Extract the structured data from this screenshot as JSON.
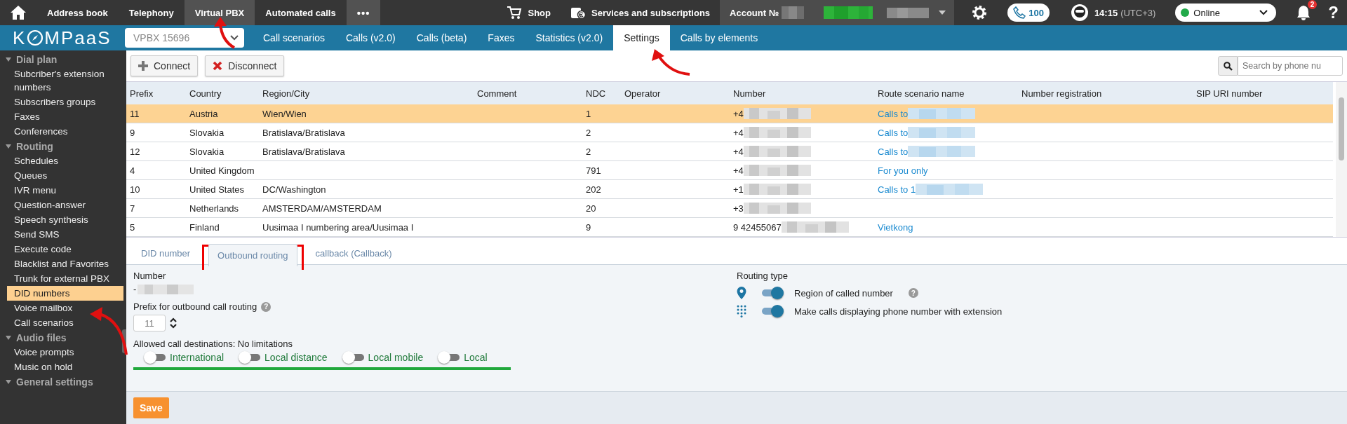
{
  "top_nav": {
    "items": [
      {
        "label": "Address book",
        "selected": false
      },
      {
        "label": "Telephony",
        "selected": false
      },
      {
        "label": "Virtual PBX",
        "selected": true
      },
      {
        "label": "Automated calls",
        "selected": false
      }
    ],
    "more": "•••",
    "shop": "Shop",
    "services": "Services and subscriptions",
    "account": "Account №",
    "calls_count": "100",
    "time": "14:15",
    "timezone": "(UTC+3)",
    "status": "Online",
    "notifications": "2",
    "help": "?"
  },
  "logo": {
    "before": "K",
    "after": "MPaaS"
  },
  "pbx_select": "VPBX 15696",
  "tabs": [
    {
      "label": "Call scenarios",
      "selected": false
    },
    {
      "label": "Calls (v2.0)",
      "selected": false
    },
    {
      "label": "Calls (beta)",
      "selected": false
    },
    {
      "label": "Faxes",
      "selected": false
    },
    {
      "label": "Statistics (v2.0)",
      "selected": false
    },
    {
      "label": "Settings",
      "selected": true
    },
    {
      "label": "Calls by elements",
      "selected": false
    }
  ],
  "sidebar": {
    "groups": [
      {
        "title": "Dial plan",
        "expanded": true,
        "items": [
          {
            "label": "Subcriber's extension numbers",
            "selected": false
          },
          {
            "label": "Subscribers groups",
            "selected": false
          },
          {
            "label": "Faxes",
            "selected": false
          },
          {
            "label": "Conferences",
            "selected": false
          }
        ]
      },
      {
        "title": "Routing",
        "expanded": true,
        "items": [
          {
            "label": "Schedules",
            "selected": false
          },
          {
            "label": "Queues",
            "selected": false
          },
          {
            "label": "IVR menu",
            "selected": false
          },
          {
            "label": "Question-answer",
            "selected": false
          },
          {
            "label": "Speech synthesis",
            "selected": false
          },
          {
            "label": "Send SMS",
            "selected": false
          },
          {
            "label": "Execute code",
            "selected": false
          },
          {
            "label": "Blacklist and Favorites",
            "selected": false
          },
          {
            "label": "Trunk for external PBX",
            "selected": false
          },
          {
            "label": "DID numbers",
            "selected": true
          },
          {
            "label": "Voice mailbox",
            "selected": false
          },
          {
            "label": "Call scenarios",
            "selected": false
          }
        ]
      },
      {
        "title": "Audio files",
        "expanded": true,
        "items": [
          {
            "label": "Voice prompts",
            "selected": false
          },
          {
            "label": "Music on hold",
            "selected": false
          }
        ]
      },
      {
        "title": "General settings",
        "expanded": true
      }
    ]
  },
  "toolbar": {
    "connect": "Connect",
    "disconnect": "Disconnect",
    "search_placeholder": "Search by phone nu"
  },
  "table": {
    "columns": [
      "Prefix",
      "Country",
      "Region/City",
      "Comment",
      "NDC",
      "Operator",
      "Number",
      "Route scenario name",
      "Number registration",
      "SIP URI number"
    ],
    "rows": [
      {
        "selected": true,
        "prefix": "11",
        "country": "Austria",
        "region": "Wien/Wien",
        "ndc": "1",
        "number": {
          "text": "+4",
          "blurred": true
        },
        "route": {
          "text": "Calls to",
          "blurred": true
        }
      },
      {
        "selected": false,
        "prefix": "9",
        "country": "Slovakia",
        "region": "Bratislava/Bratislava",
        "ndc": "2",
        "number": {
          "text": "+4",
          "blurred": true
        },
        "route": {
          "text": "Calls to",
          "blurred": true
        }
      },
      {
        "selected": false,
        "prefix": "12",
        "country": "Slovakia",
        "region": "Bratislava/Bratislava",
        "ndc": "2",
        "number": {
          "text": "+4",
          "blurred": true
        },
        "route": {
          "text": "Calls to",
          "blurred": true
        }
      },
      {
        "selected": false,
        "prefix": "4",
        "country": "United Kingdom",
        "ndc": "791",
        "number": {
          "text": "+4",
          "blurred": true
        },
        "route": {
          "text": "For you only",
          "blurred": false
        }
      },
      {
        "selected": false,
        "prefix": "10",
        "country": "United States",
        "region": "DC/Washington",
        "ndc": "202",
        "number": {
          "text": "+1",
          "blurred": true
        },
        "route": {
          "text": "Calls to 1",
          "blurred": true
        }
      },
      {
        "selected": false,
        "prefix": "7",
        "country": "Netherlands",
        "region": "AMSTERDAM/AMSTERDAM",
        "ndc": "20",
        "number": {
          "text": "+3",
          "blurred": true
        }
      },
      {
        "selected": false,
        "prefix": "5",
        "country": "Finland",
        "region": "Uusimaa I numbering area/Uusimaa I",
        "ndc": "9",
        "number": {
          "text": "9 42455067",
          "blurred": true
        },
        "route": {
          "text": "Vietkong",
          "blurred": false
        }
      }
    ]
  },
  "detail_tabs": [
    {
      "label": "DID number",
      "selected": false
    },
    {
      "label": "Outbound routing",
      "selected": true
    },
    {
      "label": "callback (Callback)",
      "selected": false
    }
  ],
  "form": {
    "number_label": "Number",
    "number_value": "-",
    "prefix_label": "Prefix for outbound call routing",
    "prefix_help": "?",
    "prefix_value": "11",
    "destinations_label": "Allowed call destinations: No limitations",
    "destinations": [
      {
        "label": "International",
        "on": false
      },
      {
        "label": "Local distance",
        "on": false
      },
      {
        "label": "Local mobile",
        "on": false
      },
      {
        "label": "Local",
        "on": false
      }
    ],
    "routing_label": "Routing type",
    "routing": [
      {
        "kind": "pin",
        "label": "Region of called number",
        "on": true,
        "help": "?"
      },
      {
        "kind": "keypad",
        "label": "Make calls displaying phone number with extension",
        "on": true
      }
    ],
    "save": "Save"
  }
}
